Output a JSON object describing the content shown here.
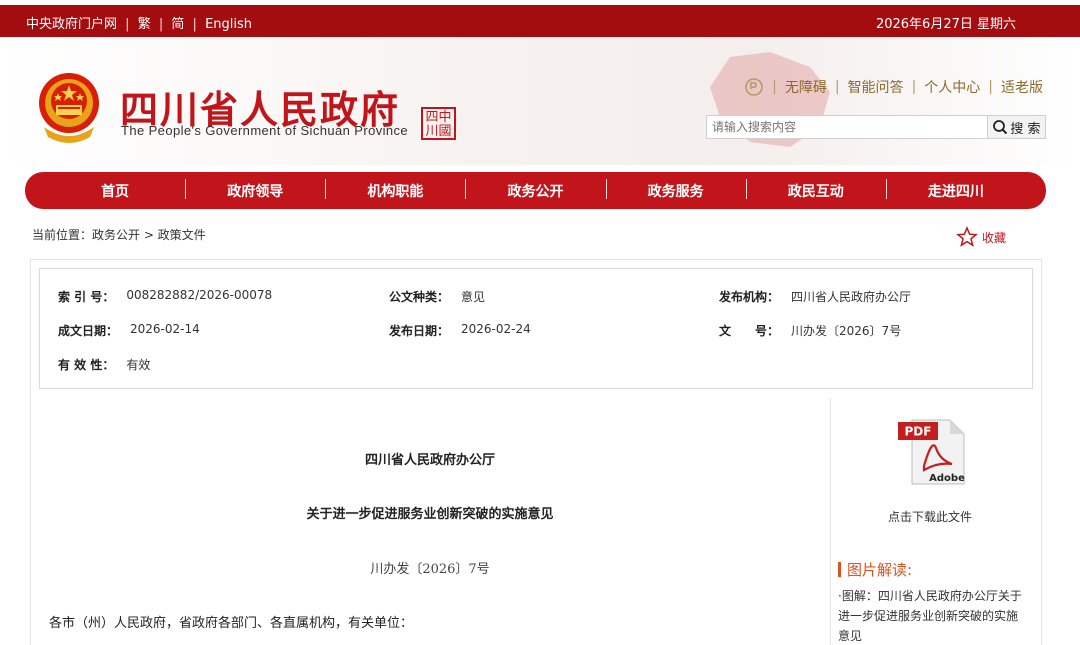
{
  "topbar": {
    "links": [
      "中央政府门户网",
      "繁",
      "简",
      "English"
    ],
    "separator": "|",
    "date": "2026年6月27日 星期六"
  },
  "header": {
    "title": "四川省人民政府",
    "subtitle_en": "The People's Government of Sichuan Province",
    "seal_line1": "四中",
    "seal_line2": "川國",
    "utility": [
      "无障碍",
      "智能问答",
      "个人中心",
      "适老版"
    ],
    "divider": "|",
    "search_placeholder": "请输入搜索内容",
    "search_button": "搜 索"
  },
  "nav": {
    "items": [
      "首页",
      "政府领导",
      "机构职能",
      "政务公开",
      "政务服务",
      "政民互动",
      "走进四川"
    ]
  },
  "breadcrumb": "当前位置：政务公开 > 政策文件",
  "favorite": "收藏",
  "meta": {
    "index_label": "索 引 号：",
    "index_value": "008282882/2026-00078",
    "type_label": "公文种类：",
    "type_value": "意见",
    "issuer_label": "发布机构：",
    "issuer_value": "四川省人民政府办公厅",
    "date_label": "成文日期：",
    "date_value": "2026-02-14",
    "pub_label": "发布日期：",
    "pub_value": "2026-02-24",
    "docno_label": "文　　号：",
    "docno_value": "川办发〔2026〕7号",
    "valid_label": "有 效 性：",
    "valid_value": "有效"
  },
  "article": {
    "issuer": "四川省人民政府办公厅",
    "title": "关于进一步促进服务业创新突破的实施意见",
    "doc_number": "川办发〔2026〕7号",
    "salutation": "各市（州）人民政府，省政府各部门、各直属机构，有关单位："
  },
  "side": {
    "pdf_label": "PDF",
    "adobe_label": "Adobe",
    "download": "点击下载此文件",
    "pic_heading": "图片解读:",
    "pic_text": "·图解：四川省人民政府办公厅关于进一步促进服务业创新突破的实施意见"
  },
  "colors": {
    "brand_red": "#c1151b",
    "topbar_red": "#a40d0f",
    "accent_orange": "#d9531e"
  }
}
